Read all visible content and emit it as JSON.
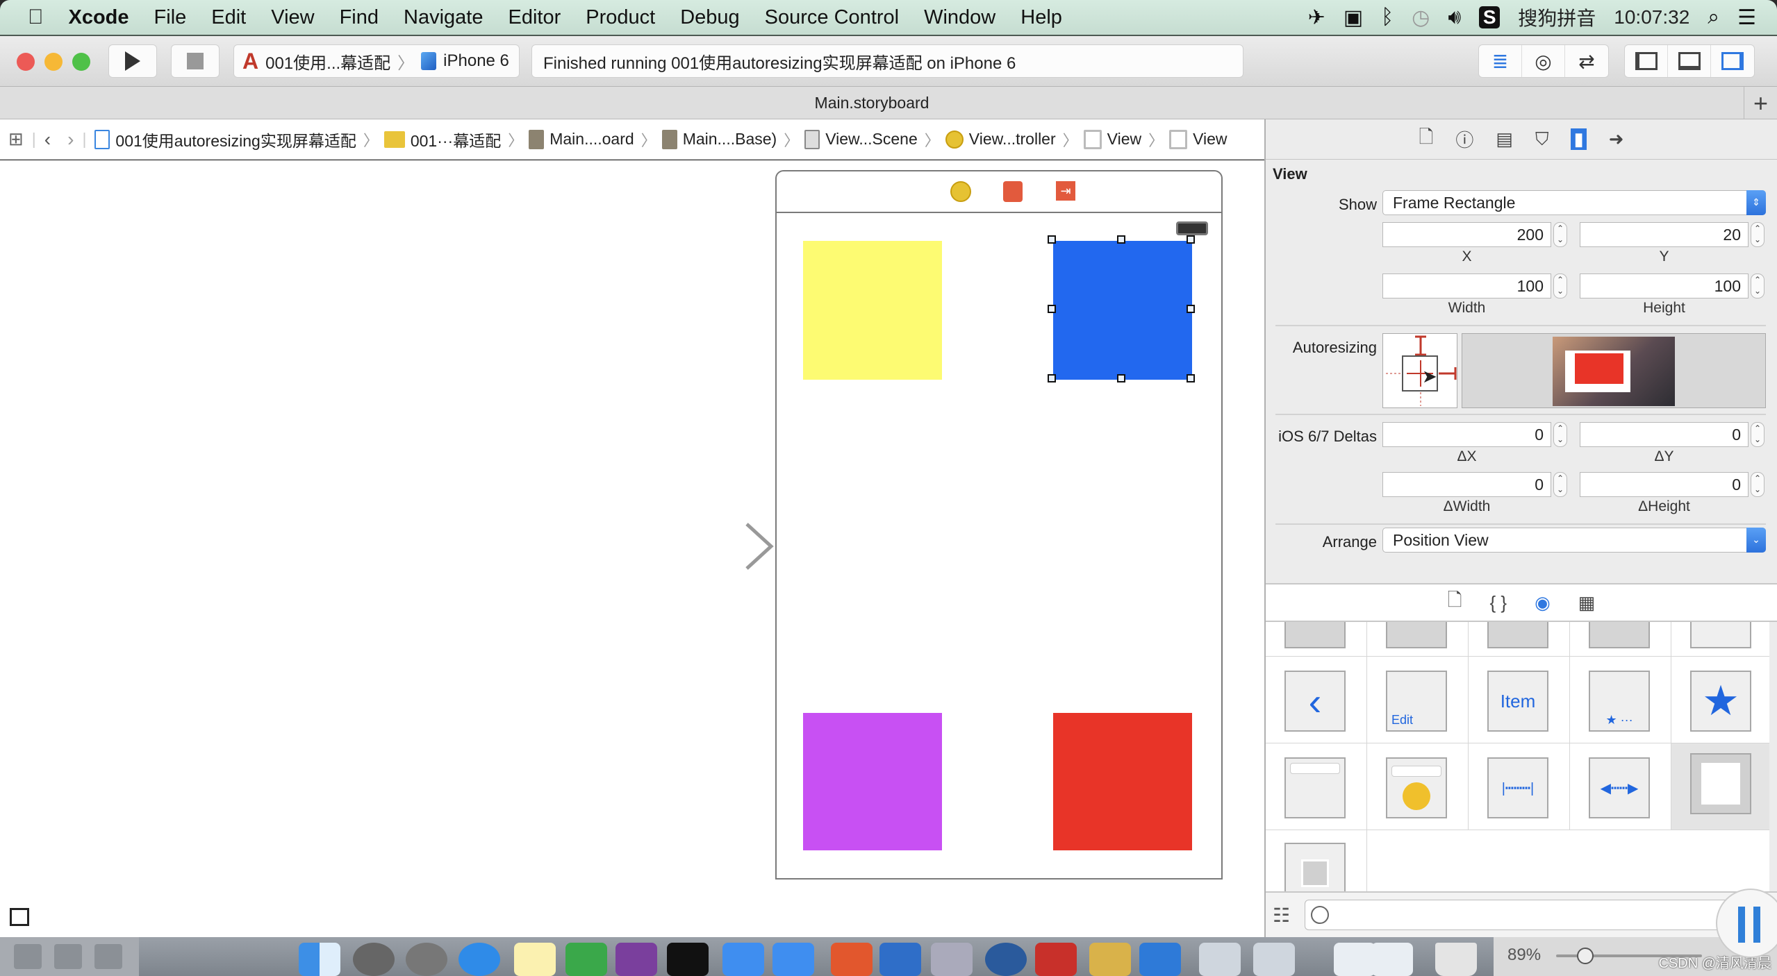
{
  "menubar": {
    "app": "Xcode",
    "items": [
      "File",
      "Edit",
      "View",
      "Find",
      "Navigate",
      "Editor",
      "Product",
      "Debug",
      "Source Control",
      "Window",
      "Help"
    ],
    "input_method": "搜狗拼音",
    "clock": "10:07:32"
  },
  "toolbar": {
    "scheme": "001使用...幕适配",
    "device": "iPhone 6",
    "activity": "Finished running 001使用autoresizing实现屏幕适配 on iPhone 6"
  },
  "tab": {
    "title": "Main.storyboard"
  },
  "jumpbar": {
    "items": [
      {
        "label": "001使用autoresizing实现屏幕适配",
        "icon": "project-file-icon"
      },
      {
        "label": "001···幕适配",
        "icon": "folder-icon"
      },
      {
        "label": "Main....oard",
        "icon": "storyboard-file-icon"
      },
      {
        "label": "Main....Base)",
        "icon": "storyboard-file-icon"
      },
      {
        "label": "View...Scene",
        "icon": "scene-icon"
      },
      {
        "label": "View...troller",
        "icon": "view-controller-icon"
      },
      {
        "label": "View",
        "icon": "view-icon"
      },
      {
        "label": "View",
        "icon": "view-icon"
      }
    ]
  },
  "canvas": {
    "views": [
      {
        "name": "yellow-view",
        "color": "#fdfb72",
        "selected": false
      },
      {
        "name": "blue-view",
        "color": "#2268ef",
        "selected": true
      },
      {
        "name": "purple-view",
        "color": "#c850f3",
        "selected": false
      },
      {
        "name": "red-view",
        "color": "#e83428",
        "selected": false
      }
    ]
  },
  "inspector": {
    "section_title": "View",
    "show_label": "Show",
    "show_value": "Frame Rectangle",
    "x_value": "200",
    "y_value": "20",
    "width_value": "100",
    "height_value": "100",
    "x_label": "X",
    "y_label": "Y",
    "width_label": "Width",
    "height_label": "Height",
    "autoresizing_label": "Autoresizing",
    "deltas_label": "iOS 6/7 Deltas",
    "dx_value": "0",
    "dy_value": "0",
    "dwidth_value": "0",
    "dheight_value": "0",
    "dx_label": "ΔX",
    "dy_label": "ΔY",
    "dwidth_label": "ΔWidth",
    "dheight_label": "ΔHeight",
    "arrange_label": "Arrange",
    "arrange_value": "Position View"
  },
  "library": {
    "items": [
      {
        "name": "library-item-bar-button-back",
        "text": "‹"
      },
      {
        "name": "library-item-edit-button",
        "text": "Edit"
      },
      {
        "name": "library-item-bar-item",
        "text": "Item"
      },
      {
        "name": "library-item-tab-bar",
        "text": "★ ···"
      },
      {
        "name": "library-item-tab-bar-item",
        "text": "★"
      }
    ]
  },
  "dock": {
    "zoom": "89%",
    "zoom_fraction": 0.2,
    "watermark": "CSDN @清风清晨"
  }
}
